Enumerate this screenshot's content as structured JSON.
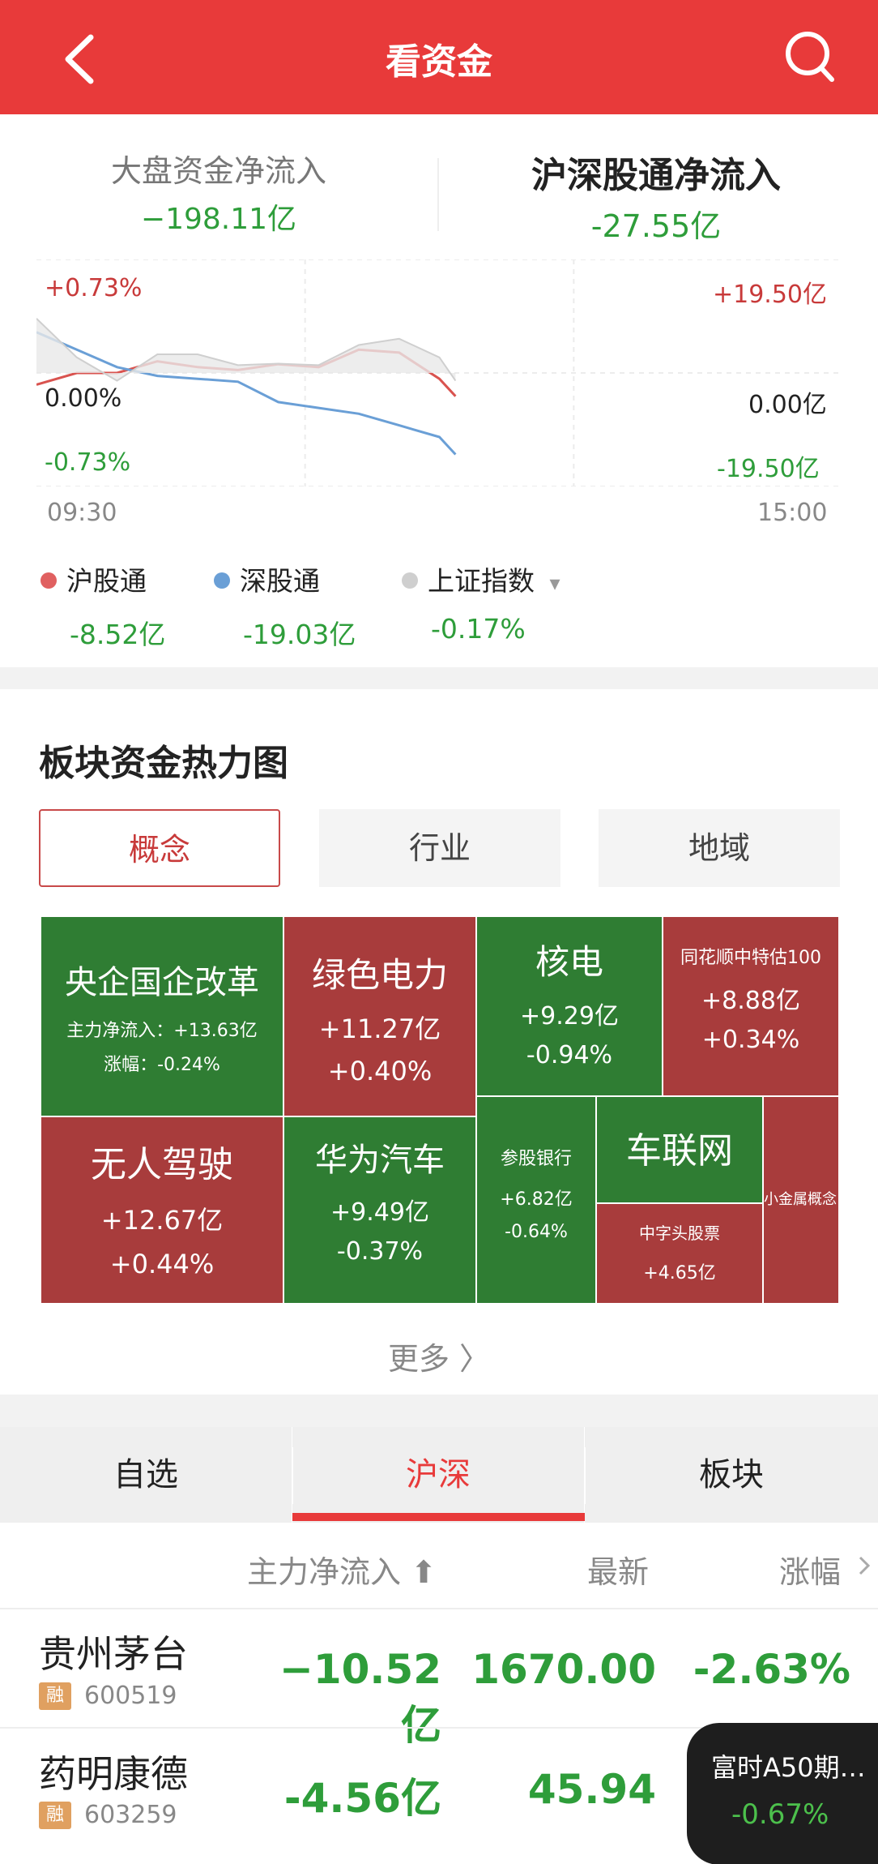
{
  "header": {
    "title": "看资金"
  },
  "flows": {
    "market_label": "大盘资金净流入",
    "market_value": "−198.11亿",
    "connect_label": "沪深股通净流入",
    "connect_value": "-27.55亿"
  },
  "chart_axis": {
    "left_top": "+0.73%",
    "left_mid": "0.00%",
    "left_bottom": "-0.73%",
    "right_top": "+19.50亿",
    "right_mid": "0.00亿",
    "right_bottom": "-19.50亿",
    "time_start": "09:30",
    "time_end": "15:00"
  },
  "chart_data": {
    "type": "line",
    "title": "",
    "x_range": [
      "09:30",
      "15:00"
    ],
    "y_left_range": [
      -0.73,
      0.73
    ],
    "y_right_range": [
      -19.5,
      19.5
    ],
    "series": [
      {
        "name": "沪股通",
        "color": "#d9534f",
        "axis": "right",
        "x": [
          0,
          0.05,
          0.1,
          0.15,
          0.2,
          0.25,
          0.3,
          0.35,
          0.4,
          0.45,
          0.5,
          0.52
        ],
        "y": [
          -2,
          0,
          0,
          2,
          1,
          0.5,
          1.5,
          1,
          4,
          3.5,
          -1,
          -4
        ]
      },
      {
        "name": "深股通",
        "color": "#6a9fd6",
        "axis": "right",
        "x": [
          0,
          0.05,
          0.1,
          0.15,
          0.2,
          0.25,
          0.3,
          0.35,
          0.4,
          0.45,
          0.5,
          0.52
        ],
        "y": [
          7,
          4,
          1,
          -0.5,
          -1,
          -1.5,
          -5,
          -6,
          -7,
          -9,
          -11,
          -14
        ]
      },
      {
        "name": "上证指数",
        "color": "#cfcfcf",
        "axis": "left",
        "x": [
          0,
          0.05,
          0.1,
          0.15,
          0.2,
          0.25,
          0.3,
          0.35,
          0.4,
          0.45,
          0.5,
          0.52
        ],
        "y": [
          0.35,
          0.1,
          -0.05,
          0.12,
          0.12,
          0.05,
          0.06,
          0.05,
          0.18,
          0.22,
          0.1,
          -0.05
        ]
      }
    ],
    "grid": true
  },
  "legend": [
    {
      "label": "沪股通",
      "value": "-8.52亿",
      "color": "#e06060"
    },
    {
      "label": "深股通",
      "value": "-19.03亿",
      "color": "#6a9fd6"
    },
    {
      "label": "上证指数",
      "value": "-0.17%",
      "color": "#cfcfcf",
      "dropdown": "▾"
    }
  ],
  "heatmap": {
    "title": "板块资金热力图",
    "tabs": [
      "概念",
      "行业",
      "地域"
    ],
    "cells": [
      {
        "name": "央企国企改革",
        "line1": "主力净流入：+13.63亿",
        "line2": "涨幅：-0.24%"
      },
      {
        "name": "绿色电力",
        "line1": "+11.27亿",
        "line2": "+0.40%"
      },
      {
        "name": "核电",
        "line1": "+9.29亿",
        "line2": "-0.94%"
      },
      {
        "name": "同花顺中特估100",
        "line1": "+8.88亿",
        "line2": "+0.34%"
      },
      {
        "name": "无人驾驶",
        "line1": "+12.67亿",
        "line2": "+0.44%"
      },
      {
        "name": "华为汽车",
        "line1": "+9.49亿",
        "line2": "-0.37%"
      },
      {
        "name": "参股银行",
        "line1": "+6.82亿",
        "line2": "-0.64%"
      },
      {
        "name": "车联网",
        "line1": "",
        "line2": ""
      },
      {
        "name": "中字头股票",
        "line1": "+4.65亿",
        "line2": ""
      },
      {
        "name": "小金属概念",
        "line1": "",
        "line2": ""
      }
    ],
    "more": "更多 〉"
  },
  "bottom_tabs": [
    "自选",
    "沪深",
    "板块"
  ],
  "table": {
    "headers": {
      "flow": "主力净流入 ⬆",
      "latest": "最新",
      "change": "涨幅"
    },
    "rows": [
      {
        "name": "贵州茅台",
        "badge": "融",
        "code": "600519",
        "flow": "−10.52亿",
        "latest": "1670.00",
        "change": "-2.63%"
      },
      {
        "name": "药明康德",
        "badge": "融",
        "code": "603259",
        "flow": "-4.56亿",
        "latest": "45.94",
        "change": ""
      }
    ]
  },
  "floating": {
    "title": "富时A50期…",
    "value": "-0.67%"
  }
}
